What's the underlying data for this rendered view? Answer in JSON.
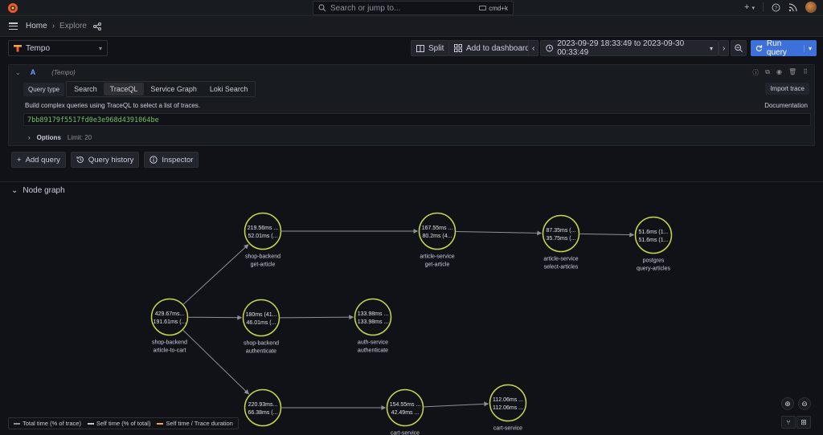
{
  "topbar": {
    "search_placeholder": "Search or jump to...",
    "shortcut": "cmd+k",
    "plus_label": "+"
  },
  "breadcrumb": {
    "home": "Home",
    "current": "Explore"
  },
  "toolbar": {
    "datasource": "Tempo",
    "split_label": "Split",
    "add_dashboard_label": "Add to dashboard",
    "time_range": "2023-09-29 18:33:49 to 2023-09-30 00:33:49",
    "run_label": "Run query"
  },
  "query": {
    "letter": "A",
    "datasource_note": "(Tempo)",
    "query_type_label": "Query type",
    "tabs": [
      "Search",
      "TraceQL",
      "Service Graph",
      "Loki Search"
    ],
    "active_tab": "TraceQL",
    "import_label": "Import trace",
    "help_text": "Build complex queries using TraceQL to select a list of traces.",
    "documentation_label": "Documentation",
    "value": "7bb89179f5517fd0e3e968d4391064be",
    "options_label": "Options",
    "limit_text": "Limit: 20"
  },
  "actions": {
    "add_query": "Add query",
    "history": "Query history",
    "inspector": "Inspector"
  },
  "node_graph": {
    "title": "Node graph",
    "nodes": [
      {
        "id": "n1",
        "line1": "429.67ms...",
        "line2": "191.61ms (...",
        "title": "shop-backend",
        "subtitle": "article-to-cart"
      },
      {
        "id": "n2",
        "line1": "219.56ms ...",
        "line2": "52.01ms (...",
        "title": "shop-backend",
        "subtitle": "get-article"
      },
      {
        "id": "n3",
        "line1": "180ms (41...",
        "line2": "46.01ms (...",
        "title": "shop-backend",
        "subtitle": "authenticate"
      },
      {
        "id": "n4",
        "line1": "220.93ms...",
        "line2": "66.38ms (...",
        "title": "",
        "subtitle": ""
      },
      {
        "id": "n5",
        "line1": "167.55ms ...",
        "line2": "80.2ms (4...",
        "title": "article-service",
        "subtitle": "get-article"
      },
      {
        "id": "n6",
        "line1": "133.98ms ...",
        "line2": "133.98ms ...",
        "title": "auth-service",
        "subtitle": "authenticate"
      },
      {
        "id": "n7",
        "line1": "154.55ms ...",
        "line2": "42.49ms ...",
        "title": "cart-service",
        "subtitle": ""
      },
      {
        "id": "n8",
        "line1": "87.35ms (...",
        "line2": "35.75ms (...",
        "title": "article-service",
        "subtitle": "select-articles"
      },
      {
        "id": "n9",
        "line1": "112.06ms ...",
        "line2": "112.06ms ...",
        "title": "cart-service",
        "subtitle": ""
      },
      {
        "id": "n10",
        "line1": "51.6ms (1...",
        "line2": "51.6ms (1...",
        "title": "postgres",
        "subtitle": "query-articles"
      }
    ],
    "edges": [
      [
        "n1",
        "n2"
      ],
      [
        "n1",
        "n3"
      ],
      [
        "n1",
        "n4"
      ],
      [
        "n2",
        "n5"
      ],
      [
        "n5",
        "n8"
      ],
      [
        "n8",
        "n10"
      ],
      [
        "n3",
        "n6"
      ],
      [
        "n4",
        "n7"
      ],
      [
        "n7",
        "n9"
      ]
    ],
    "legend": {
      "total": "Total time (% of trace)",
      "self": "Self time (% of total)",
      "duration": "Self time / Trace duration"
    },
    "colors": {
      "node_stroke": "#c8d64a",
      "edge": "#8e8e9a",
      "legend_total": "#8e8e9a",
      "legend_self": "#c8c8c8",
      "legend_duration": "#f2a64a"
    }
  }
}
